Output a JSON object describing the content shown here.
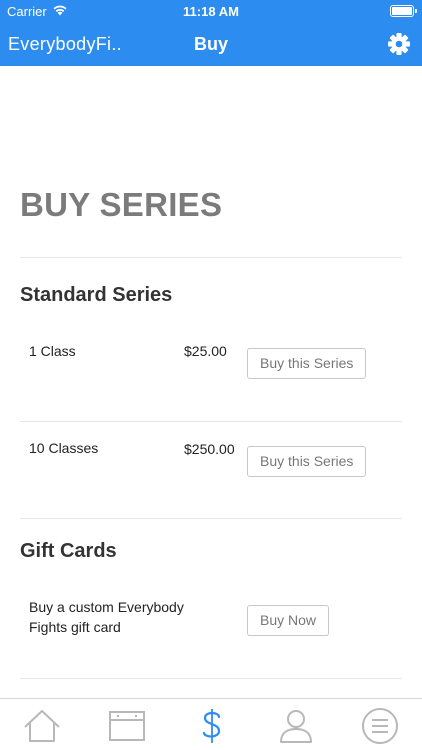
{
  "status_bar": {
    "carrier": "Carrier",
    "time": "11:18 AM",
    "wifi_icon": "wifi-icon",
    "battery_icon": "battery-icon"
  },
  "nav_bar": {
    "app_name": "EverybodyFi..",
    "title": "Buy",
    "settings_icon": "gear-icon",
    "color": "#2d8cf0"
  },
  "page": {
    "heading": "BUY SERIES"
  },
  "standard_series": {
    "title": "Standard Series",
    "items": [
      {
        "name": "1 Class",
        "price": "$25.00",
        "button": "Buy this Series"
      },
      {
        "name": "10 Classes",
        "price": "$250.00",
        "button": "Buy this Series"
      }
    ]
  },
  "gift_cards": {
    "title": "Gift Cards",
    "description": "Buy a custom Everybody Fights gift card",
    "button": "Buy Now"
  },
  "tab_bar": {
    "tabs": [
      {
        "icon": "home-icon"
      },
      {
        "icon": "schedule-icon"
      },
      {
        "icon": "dollar-icon",
        "active": true
      },
      {
        "icon": "profile-icon"
      },
      {
        "icon": "menu-icon"
      }
    ],
    "active_color": "#2d8cf0",
    "inactive_color": "#b8b8b8"
  }
}
